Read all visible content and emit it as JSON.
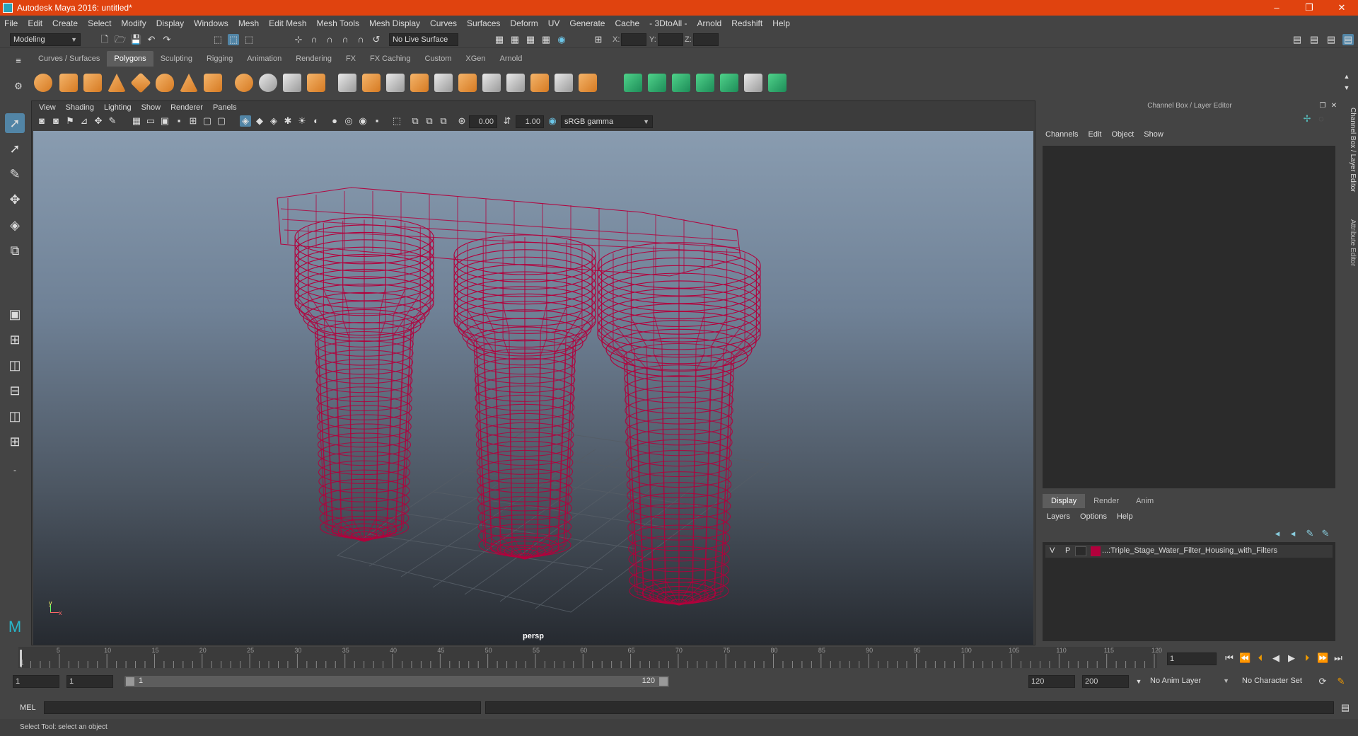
{
  "window": {
    "title": "Autodesk Maya 2016: untitled*",
    "controls": [
      "–",
      "❐",
      "✕"
    ]
  },
  "menubar": [
    "File",
    "Edit",
    "Create",
    "Select",
    "Modify",
    "Display",
    "Windows",
    "Mesh",
    "Edit Mesh",
    "Mesh Tools",
    "Mesh Display",
    "Curves",
    "Surfaces",
    "Deform",
    "UV",
    "Generate",
    "Cache",
    "- 3DtoAll -",
    "Arnold",
    "Redshift",
    "Help"
  ],
  "statusline": {
    "mode": "Modeling",
    "live_surface": "No Live Surface",
    "x_label": "X:",
    "y_label": "Y:",
    "z_label": "Z:"
  },
  "shelf": {
    "tabs": [
      "Curves / Surfaces",
      "Polygons",
      "Sculpting",
      "Rigging",
      "Animation",
      "Rendering",
      "FX",
      "FX Caching",
      "Custom",
      "XGen",
      "Arnold"
    ],
    "active_tab": "Polygons"
  },
  "viewport": {
    "menu": [
      "View",
      "Shading",
      "Lighting",
      "Show",
      "Renderer",
      "Panels"
    ],
    "exposure": "0.00",
    "gamma": "1.00",
    "color_space": "sRGB gamma",
    "camera": "persp",
    "wire_color": "#b3003c",
    "axis_y": "y",
    "axis_x": "x"
  },
  "channel_box": {
    "header": "Channel Box / Layer Editor",
    "menu": [
      "Channels",
      "Edit",
      "Object",
      "Show"
    ]
  },
  "layer_editor": {
    "tabs": [
      "Display",
      "Render",
      "Anim"
    ],
    "active_tab": "Display",
    "menu": [
      "Layers",
      "Options",
      "Help"
    ],
    "layer": {
      "v": "V",
      "p": "P",
      "color": "#b3003c",
      "name": "...:Triple_Stage_Water_Filter_Housing_with_Filters"
    }
  },
  "side_tabs": [
    "Channel Box / Layer Editor",
    "Attribute Editor"
  ],
  "timeline": {
    "ticks": [
      "5",
      "10",
      "15",
      "20",
      "25",
      "30",
      "35",
      "40",
      "45",
      "50",
      "55",
      "60",
      "65",
      "70",
      "75",
      "80",
      "85",
      "90",
      "95",
      "100",
      "105",
      "110",
      "115",
      "120"
    ],
    "start_label": "1",
    "current_frame": "1"
  },
  "range": {
    "start": "1",
    "inner_start": "1",
    "slider_start": "1",
    "slider_end": "120",
    "end": "120",
    "max_end": "200",
    "anim_layer": "No Anim Layer",
    "char_set": "No Character Set"
  },
  "cmdline": {
    "label": "MEL"
  },
  "helpline": "Select Tool: select an object"
}
